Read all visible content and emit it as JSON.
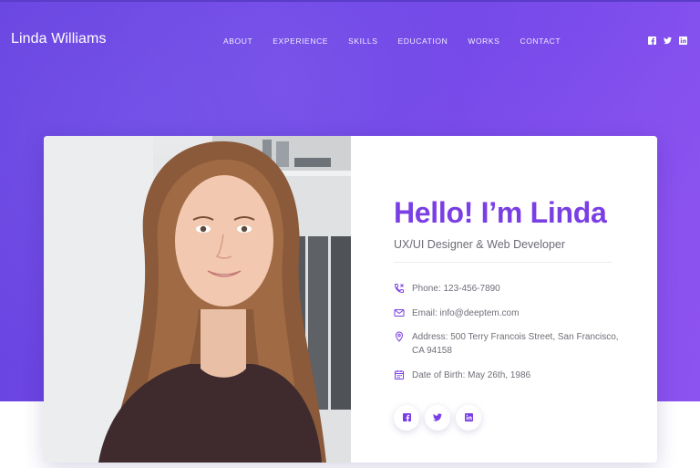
{
  "header": {
    "brand": "Linda Williams",
    "nav": [
      "ABOUT",
      "EXPERIENCE",
      "SKILLS",
      "EDUCATION",
      "WORKS",
      "CONTACT"
    ],
    "social_icons": [
      "facebook-icon",
      "twitter-icon",
      "linkedin-icon"
    ]
  },
  "profile": {
    "greeting": "Hello! I’m Linda",
    "role": "UX/UI Designer & Web Developer",
    "phone": "Phone: 123-456-7890",
    "email": "Email: info@deeptem.com",
    "address": "Address: 500 Terry Francois Street, San Francisco, CA 94158",
    "dob": "Date of Birth: May 26th, 1986",
    "social_icons": [
      "facebook-icon",
      "twitter-icon",
      "linkedin-icon"
    ]
  },
  "colors": {
    "accent": "#7a3fe4",
    "hero_start": "#6a44e0",
    "hero_end": "#8a52f0",
    "text_muted": "#6f6f78"
  }
}
